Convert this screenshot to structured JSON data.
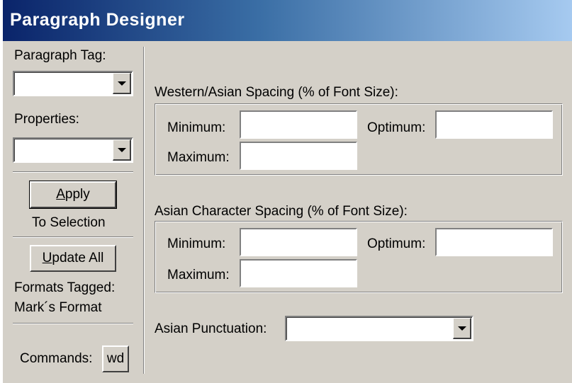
{
  "window": {
    "title": "Paragraph Designer"
  },
  "sidebar": {
    "paragraph_tag_label": "Paragraph Tag:",
    "paragraph_tag_value": "",
    "properties_label": "Properties:",
    "properties_value": "",
    "apply_mnemonic": "A",
    "apply_rest": "pply",
    "to_selection": "To Selection",
    "update_mnemonic": "U",
    "update_rest": "pdate All",
    "formats_tagged_label": "Formats Tagged:",
    "formats_tagged_value": "Mark´s Format",
    "commands_label": "Commands:",
    "commands_button": "wd"
  },
  "main": {
    "western_asian": {
      "heading": "Western/Asian Spacing (% of Font Size):",
      "minimum_label": "Minimum:",
      "optimum_label": "Optimum:",
      "maximum_label": "Maximum:",
      "minimum_value": "",
      "optimum_value": "",
      "maximum_value": ""
    },
    "asian_character": {
      "heading": "Asian Character Spacing (% of Font Size):",
      "minimum_label": "Minimum:",
      "optimum_label": "Optimum:",
      "maximum_label": "Maximum:",
      "minimum_value": "",
      "optimum_value": "",
      "maximum_value": ""
    },
    "asian_punctuation": {
      "label": "Asian Punctuation:",
      "value": ""
    }
  }
}
